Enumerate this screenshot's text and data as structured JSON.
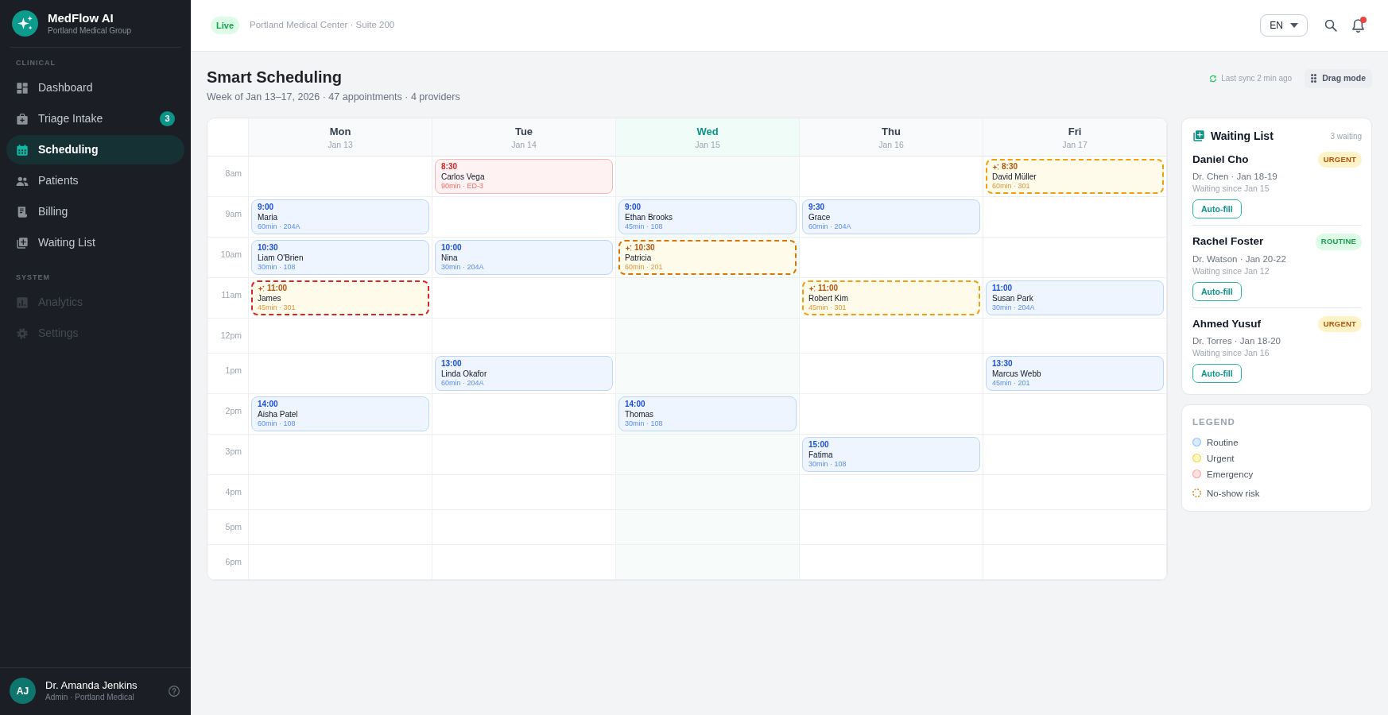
{
  "sidebar": {
    "brand": {
      "name": "MedFlow AI",
      "subtitle": "Portland Medical Group"
    },
    "sections": [
      {
        "title": "CLINICAL",
        "items": [
          {
            "label": "Dashboard",
            "selected": false,
            "disabled": false
          },
          {
            "label": "Triage Intake",
            "badge": "3",
            "selected": false,
            "disabled": false
          },
          {
            "label": "Scheduling",
            "selected": true,
            "disabled": false
          },
          {
            "label": "Patients",
            "selected": false,
            "disabled": false
          },
          {
            "label": "Billing",
            "selected": false,
            "disabled": false
          },
          {
            "label": "Waiting List",
            "selected": false,
            "disabled": false
          }
        ]
      },
      {
        "title": "SYSTEM",
        "items": [
          {
            "label": "Analytics",
            "selected": false,
            "disabled": true
          },
          {
            "label": "Settings",
            "selected": false,
            "disabled": true
          }
        ]
      }
    ],
    "user": {
      "initials": "AJ",
      "name": "Dr. Amanda Jenkins",
      "role": "Admin · Portland Medical"
    }
  },
  "topbar": {
    "status": "Live",
    "location": "Portland Medical Center · Suite 200",
    "language": "EN",
    "notifications_unread": true
  },
  "page": {
    "title": "Smart Scheduling",
    "subtitle": "Week of Jan 13–17, 2026 · 47 appointments · 4 providers",
    "sync": "Last sync 2 min ago",
    "drag_mode": "Drag mode"
  },
  "calendar": {
    "days": [
      {
        "name": "Mon",
        "date": "Jan 13",
        "today": false
      },
      {
        "name": "Tue",
        "date": "Jan 14",
        "today": false
      },
      {
        "name": "Wed",
        "date": "Jan 15",
        "today": true
      },
      {
        "name": "Thu",
        "date": "Jan 16",
        "today": false
      },
      {
        "name": "Fri",
        "date": "Jan 17",
        "today": false
      }
    ],
    "rows": [
      {
        "time": "8am",
        "cells": [
          null,
          {
            "time": "8:30",
            "patient": "Carlos Vega",
            "details": "90min · ED-3",
            "kind": "emergency",
            "no_show_risk": false
          },
          null,
          null,
          {
            "time": "8:30",
            "patient": "David Müller",
            "details": "60min · 301",
            "kind": "urgent",
            "no_show_risk": true,
            "color": "#f59e0b"
          }
        ]
      },
      {
        "time": "9am",
        "cells": [
          {
            "time": "9:00",
            "patient": "Maria",
            "details": "60min · 204A",
            "kind": "routine",
            "no_show_risk": false
          },
          null,
          {
            "time": "9:00",
            "patient": "Ethan Brooks",
            "details": "45min · 108",
            "kind": "routine",
            "no_show_risk": false
          },
          {
            "time": "9:30",
            "patient": "Grace",
            "details": "60min · 204A",
            "kind": "routine",
            "no_show_risk": false
          },
          null
        ]
      },
      {
        "time": "10am",
        "cells": [
          {
            "time": "10:30",
            "patient": "Liam O'Brien",
            "details": "30min · 108",
            "kind": "routine",
            "no_show_risk": false
          },
          {
            "time": "10:00",
            "patient": "Nina",
            "details": "30min · 204A",
            "kind": "routine",
            "no_show_risk": false
          },
          {
            "time": "10:30",
            "patient": "Patricia",
            "details": "60min · 201",
            "kind": "urgent",
            "no_show_risk": true,
            "color": "#d97706"
          },
          null,
          null
        ]
      },
      {
        "time": "11am",
        "cells": [
          {
            "time": "11:00",
            "patient": "James",
            "details": "45min · 301",
            "kind": "urgent",
            "no_show_risk": true,
            "color": "#dc2626"
          },
          null,
          null,
          {
            "time": "11:00",
            "patient": "Robert Kim",
            "details": "45min · 301",
            "kind": "urgent",
            "no_show_risk": true,
            "color": "#f59e0b"
          },
          {
            "time": "11:00",
            "patient": "Susan Park",
            "details": "30min · 204A",
            "kind": "routine",
            "no_show_risk": false
          }
        ]
      },
      {
        "time": "12pm",
        "cells": [
          null,
          null,
          null,
          null,
          null
        ]
      },
      {
        "time": "1pm",
        "cells": [
          null,
          {
            "time": "13:00",
            "patient": "Linda Okafor",
            "details": "60min · 204A",
            "kind": "routine",
            "no_show_risk": false
          },
          null,
          null,
          {
            "time": "13:30",
            "patient": "Marcus Webb",
            "details": "45min · 201",
            "kind": "routine",
            "no_show_risk": false
          }
        ]
      },
      {
        "time": "2pm",
        "cells": [
          {
            "time": "14:00",
            "patient": "Aisha Patel",
            "details": "60min · 108",
            "kind": "routine",
            "no_show_risk": false
          },
          null,
          {
            "time": "14:00",
            "patient": "Thomas",
            "details": "30min · 108",
            "kind": "routine",
            "no_show_risk": false
          },
          null,
          null
        ]
      },
      {
        "time": "3pm",
        "cells": [
          null,
          null,
          null,
          {
            "time": "15:00",
            "patient": "Fatima",
            "details": "30min · 108",
            "kind": "routine",
            "no_show_risk": false
          },
          null
        ]
      },
      {
        "time": "4pm",
        "cells": [
          null,
          null,
          null,
          null,
          null
        ]
      },
      {
        "time": "5pm",
        "cells": [
          null,
          null,
          null,
          null,
          null
        ]
      },
      {
        "time": "6pm",
        "cells": [
          null,
          null,
          null,
          null,
          null
        ]
      }
    ]
  },
  "waiting_list": {
    "title": "Waiting List",
    "count": "3 waiting",
    "items": [
      {
        "name": "Daniel Cho",
        "priority": "URGENT",
        "kind": "urgent",
        "provider": "Dr. Chen · Jan 18-19",
        "since": "Waiting since Jan 15",
        "action": "Auto-fill"
      },
      {
        "name": "Rachel Foster",
        "priority": "ROUTINE",
        "kind": "routine",
        "provider": "Dr. Watson · Jan 20-22",
        "since": "Waiting since Jan 12",
        "action": "Auto-fill"
      },
      {
        "name": "Ahmed Yusuf",
        "priority": "URGENT",
        "kind": "urgent",
        "provider": "Dr. Torres · Jan 18-20",
        "since": "Waiting since Jan 16",
        "action": "Auto-fill"
      }
    ]
  },
  "legend": {
    "title": "LEGEND",
    "items": [
      {
        "label": "Routine",
        "kind": "routine"
      },
      {
        "label": "Urgent",
        "kind": "urgent"
      },
      {
        "label": "Emergency",
        "kind": "emergency"
      },
      {
        "label": "No-show risk",
        "kind": "no_show"
      }
    ]
  }
}
